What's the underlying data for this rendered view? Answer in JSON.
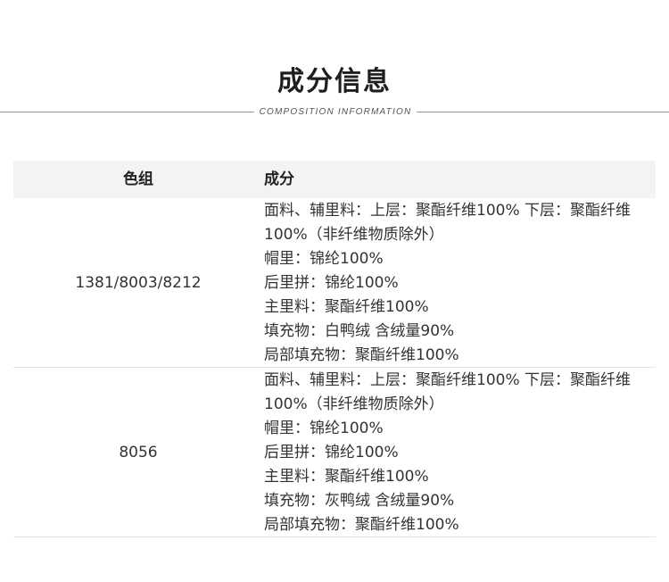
{
  "header": {
    "title": "成分信息",
    "subtitle": "COMPOSITION INFORMATION"
  },
  "table": {
    "columns": [
      "色组",
      "成分"
    ],
    "rows": [
      {
        "color_group": "1381/8003/8212",
        "composition": [
          "面料、辅里料：上层：聚酯纤维100% 下层：聚酯纤维",
          "100%（非纤维物质除外）",
          "帽里：锦纶100%",
          "后里拼：锦纶100%",
          "主里料：聚酯纤维100%",
          "填充物：白鸭绒 含绒量90%",
          "局部填充物：聚酯纤维100%"
        ]
      },
      {
        "color_group": "8056",
        "composition": [
          "面料、辅里料：上层：聚酯纤维100% 下层：聚酯纤维",
          "100%（非纤维物质除外）",
          "帽里：锦纶100%",
          "后里拼：锦纶100%",
          "主里料：聚酯纤维100%",
          "填充物：灰鸭绒 含绒量90%",
          "局部填充物：聚酯纤维100%"
        ]
      }
    ]
  }
}
